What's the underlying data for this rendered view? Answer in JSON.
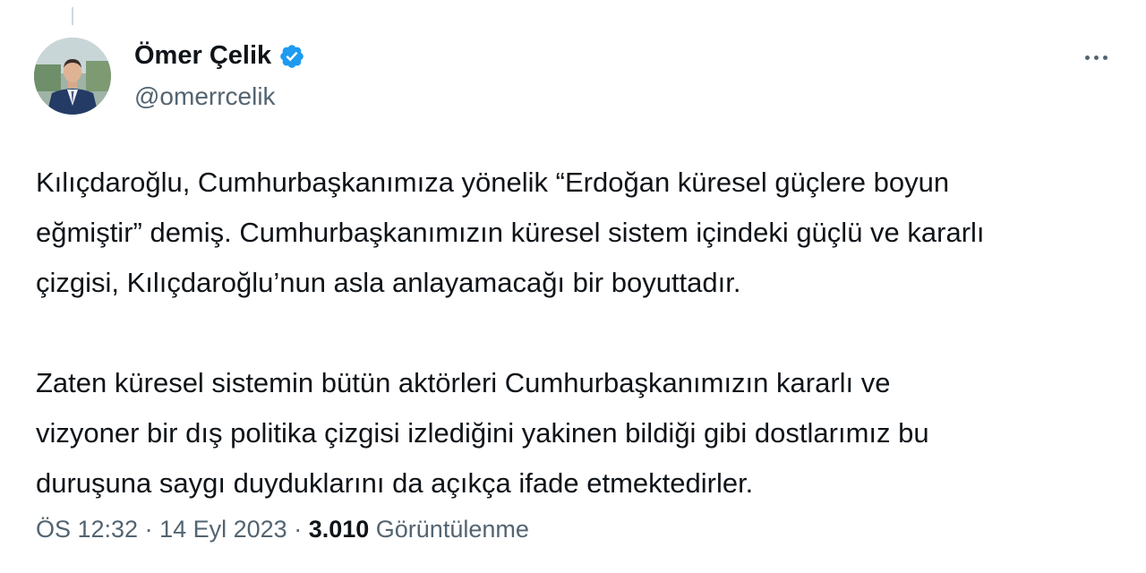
{
  "author": {
    "display_name": "Ömer Çelik",
    "handle": "@omerrcelik",
    "verified": true
  },
  "tweet": {
    "paragraphs": [
      "Kılıçdaroğlu, Cumhurbaşkanımıza yönelik “Erdoğan küresel güçlere boyun\neğmiştir” demiş. Cumhurbaşkanımızın küresel sistem içindeki güçlü ve kararlı\nçizgisi, Kılıçdaroğlu’nun asla anlayamacağı bir boyuttadır.",
      "Zaten küresel sistemin bütün aktörleri Cumhurbaşkanımızın kararlı ve\nvizyoner bir dış politika çizgisi izlediğini yakinen bildiği gibi dostlarımız bu\nduruşuna saygı duyduklarını da açıkça ifade etmektedirler."
    ]
  },
  "meta": {
    "time": "ÖS 12:32",
    "separator": " · ",
    "date": "14 Eyl 2023",
    "views_count": "3.010",
    "views_label": "Görüntülenme"
  },
  "icons": {
    "verified": "verified-badge-icon",
    "more": "more-options-icon"
  },
  "colors": {
    "verified_blue": "#1d9bf0",
    "secondary_text": "#536471",
    "primary_text": "#0f1419"
  }
}
